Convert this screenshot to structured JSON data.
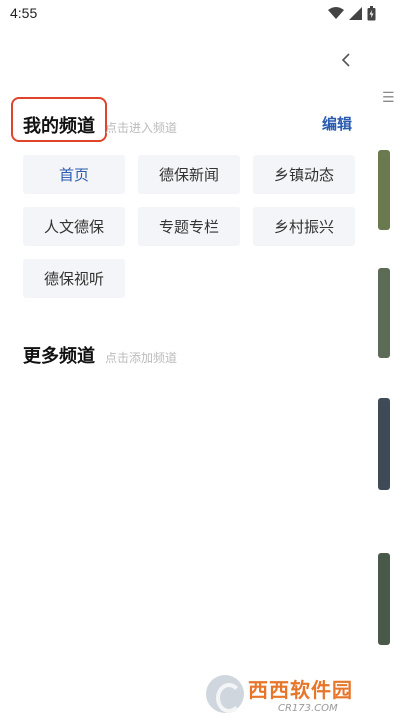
{
  "status_bar": {
    "time": "4:55"
  },
  "my_channels": {
    "title": "我的频道",
    "hint": "点击进入频道",
    "edit_label": "编辑",
    "items": [
      {
        "label": "首页",
        "active": true
      },
      {
        "label": "德保新闻"
      },
      {
        "label": "乡镇动态"
      },
      {
        "label": "人文德保"
      },
      {
        "label": "专题专栏"
      },
      {
        "label": "乡村振兴"
      },
      {
        "label": "德保视听"
      }
    ]
  },
  "more_channels": {
    "title": "更多频道",
    "hint": "点击添加频道"
  },
  "watermark": {
    "main": "西西软件园",
    "sub": "CR173.COM"
  },
  "colors": {
    "accent": "#2a5bb0",
    "highlight_outline": "#e0442a",
    "chip_bg": "#f4f5f8"
  }
}
